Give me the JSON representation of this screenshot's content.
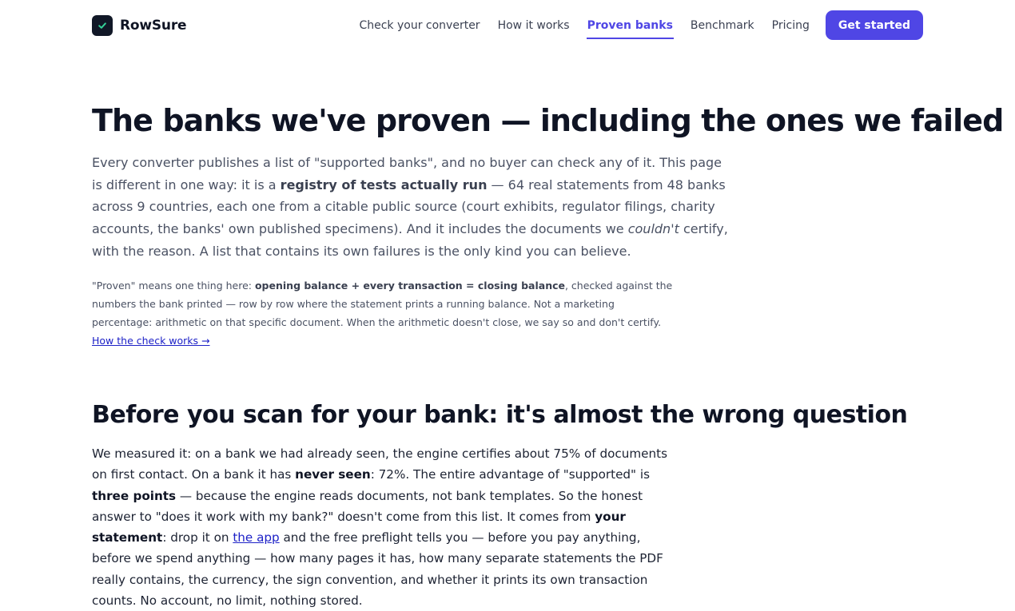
{
  "brand": {
    "name": "RowSure",
    "logo_icon": "check-icon",
    "accent": "#4f46e5"
  },
  "nav": {
    "links": [
      {
        "label": "Check your converter",
        "active": false
      },
      {
        "label": "How it works",
        "active": false
      },
      {
        "label": "Proven banks",
        "active": true
      },
      {
        "label": "Benchmark",
        "active": false
      },
      {
        "label": "Pricing",
        "active": false
      }
    ],
    "cta_label": "Get started"
  },
  "hero": {
    "title": "The banks we've proven — including the ones we failed",
    "lede": {
      "p1": "Every converter publishes a list of \"supported banks\", and no buyer can check any of it. This page is different in one way: it is a ",
      "b1": "registry of tests actually run",
      "p2": " — 64 real statements from 48 banks across 9 countries, each one from a citable public source (court exhibits, regulator filings, charity accounts, the banks' own published specimens). And it includes the documents we ",
      "em1": "couldn't",
      "p3": " certify, with the reason. A list that contains its own failures is the only kind you can believe."
    },
    "note": {
      "p1": "\"Proven\" means one thing here: ",
      "b1": "opening balance + every transaction = closing balance",
      "p2": ", checked against the numbers the bank printed — row by row where the statement prints a running balance. Not a marketing percentage: arithmetic on that specific document. When the arithmetic doesn't close, we say so and don't certify. ",
      "link": "How the check works →"
    }
  },
  "section": {
    "title": "Before you scan for your bank: it's almost the wrong question",
    "body": {
      "p1": "We measured it: on a bank we had already seen, the engine certifies about 75% of documents on first contact. On a bank it has ",
      "b1": "never seen",
      "p2": ": 72%. The entire advantage of \"supported\" is ",
      "b2": "three points",
      "p3": " — because the engine reads documents, not bank templates. So the honest answer to \"does it work with my bank?\" doesn't come from this list. It comes from ",
      "b3": "your statement",
      "p4": ": drop it on ",
      "link": "the app",
      "p5": " and the free preflight tells you — before you pay anything, before we spend anything — how many pages it has, how many separate statements the PDF really contains, the currency, the sign convention, and whether it prints its own transaction counts. No account, no limit, nothing stored."
    }
  }
}
